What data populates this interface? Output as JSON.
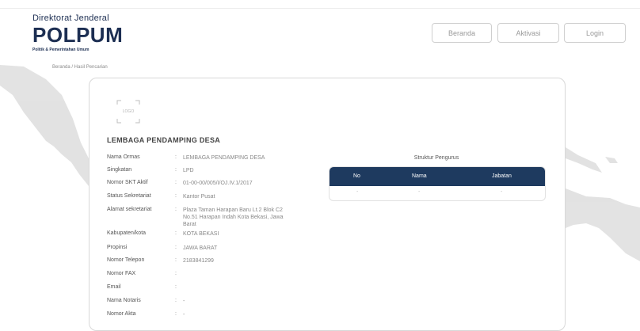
{
  "header": {
    "logo_line1": "Direktorat Jenderal",
    "logo_brand": "POLPUM",
    "logo_line3": "Politik & Pemerintahan Umum"
  },
  "nav": {
    "beranda": "Beranda",
    "aktivasi": "Aktivasi",
    "login": "Login"
  },
  "breadcrumb": "Beranda / Hasil Pencarian",
  "card": {
    "logo_placeholder": "LOGO",
    "title": "LEMBAGA PENDAMPING DESA",
    "fields": [
      {
        "label": "Nama Ormas",
        "value": "LEMBAGA PENDAMPING DESA"
      },
      {
        "label": "Singkatan",
        "value": "LPD"
      },
      {
        "label": "Nomor SKT Aktif",
        "value": "01-00-00/005/I/OJ.IV.1/2017"
      },
      {
        "label": "Status Sekretariat",
        "value": "Kantor Pusat"
      },
      {
        "label": "Alamat sekretariat",
        "value": "Plaza Taman Harapan Baru Lt.2 Blok C2 No.51 Harapan Indah Kota Bekasi, Jawa Barat"
      },
      {
        "label": "Kabupaten/kota",
        "value": "KOTA BEKASI"
      },
      {
        "label": "Propinsi",
        "value": "JAWA BARAT"
      },
      {
        "label": "Nomor Telepon",
        "value": "2183841299"
      },
      {
        "label": "Nomor FAX",
        "value": ""
      },
      {
        "label": "Email",
        "value": ""
      },
      {
        "label": "Nama Notaris",
        "value": "-"
      },
      {
        "label": "Nomor Akta",
        "value": "-"
      }
    ],
    "separator": ":",
    "struktur_title": "Struktur Pengurus",
    "table": {
      "headers": [
        "No",
        "Nama",
        "Jabatan"
      ],
      "row": [
        "-",
        "-",
        "-"
      ]
    }
  },
  "colors": {
    "brand_navy": "#1c2e52",
    "table_header": "#1e3a5f"
  }
}
